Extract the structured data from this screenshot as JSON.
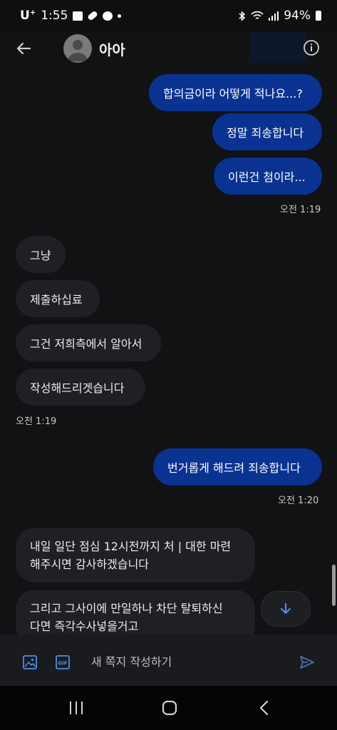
{
  "status_bar": {
    "carrier": "U",
    "carrier_sup": "+",
    "time": "1:55",
    "battery": "94%",
    "icons": [
      "image-icon",
      "capsule-icon",
      "facebook-icon",
      "dot-icon",
      "bluetooth-icon",
      "wifi-icon",
      "signal-icon",
      "battery-icon"
    ]
  },
  "header": {
    "contact_name": "아아",
    "back_icon": "arrow-left-icon",
    "info_icon": "info-icon"
  },
  "messages": [
    {
      "dir": "out",
      "text": "합의금이라 어떻게 적나요...?"
    },
    {
      "dir": "out",
      "text": "정말 죄송합니다"
    },
    {
      "dir": "out",
      "text": "이런건 첨이라..."
    },
    {
      "type": "timestamp",
      "text": "오전 1:19"
    },
    {
      "dir": "in",
      "text": "그냥"
    },
    {
      "dir": "in",
      "text": "제출하십료"
    },
    {
      "dir": "in",
      "text": "그건 저희측에서 알아서"
    },
    {
      "dir": "in",
      "text": "작성해드리겟습니다"
    },
    {
      "type": "timestamp",
      "text": "오전 1:19"
    },
    {
      "dir": "out",
      "text": "번거롭게 해드려 죄송합니다"
    },
    {
      "type": "timestamp",
      "text": "오전 1:20"
    },
    {
      "dir": "in",
      "lines": [
        "내일 일단 점심 12시전까지 처 | 대한 마련",
        "해주시면 감사하겠습니다"
      ]
    },
    {
      "dir": "in",
      "lines": [
        "그리고 그사이에 만일하나 차단 탈퇴하신",
        "다면 즉각수사넣을거고"
      ]
    }
  ],
  "composer": {
    "placeholder": "새 쪽지 작성하기",
    "value": "",
    "icons": [
      "image-icon",
      "gif-icon",
      "send-icon"
    ]
  },
  "colors": {
    "outgoing_bubble": "#0a3291",
    "incoming_bubble": "#1f2023",
    "accent": "#4a90e2"
  }
}
